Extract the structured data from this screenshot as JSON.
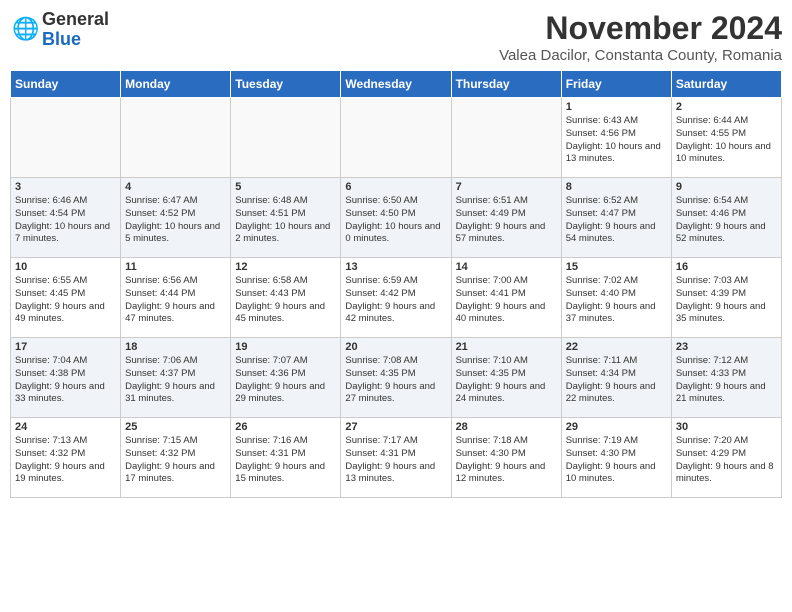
{
  "logo": {
    "general": "General",
    "blue": "Blue"
  },
  "title": "November 2024",
  "subtitle": "Valea Dacilor, Constanta County, Romania",
  "days_of_week": [
    "Sunday",
    "Monday",
    "Tuesday",
    "Wednesday",
    "Thursday",
    "Friday",
    "Saturday"
  ],
  "weeks": [
    [
      {
        "day": "",
        "info": ""
      },
      {
        "day": "",
        "info": ""
      },
      {
        "day": "",
        "info": ""
      },
      {
        "day": "",
        "info": ""
      },
      {
        "day": "",
        "info": ""
      },
      {
        "day": "1",
        "info": "Sunrise: 6:43 AM\nSunset: 4:56 PM\nDaylight: 10 hours and 13 minutes."
      },
      {
        "day": "2",
        "info": "Sunrise: 6:44 AM\nSunset: 4:55 PM\nDaylight: 10 hours and 10 minutes."
      }
    ],
    [
      {
        "day": "3",
        "info": "Sunrise: 6:46 AM\nSunset: 4:54 PM\nDaylight: 10 hours and 7 minutes."
      },
      {
        "day": "4",
        "info": "Sunrise: 6:47 AM\nSunset: 4:52 PM\nDaylight: 10 hours and 5 minutes."
      },
      {
        "day": "5",
        "info": "Sunrise: 6:48 AM\nSunset: 4:51 PM\nDaylight: 10 hours and 2 minutes."
      },
      {
        "day": "6",
        "info": "Sunrise: 6:50 AM\nSunset: 4:50 PM\nDaylight: 10 hours and 0 minutes."
      },
      {
        "day": "7",
        "info": "Sunrise: 6:51 AM\nSunset: 4:49 PM\nDaylight: 9 hours and 57 minutes."
      },
      {
        "day": "8",
        "info": "Sunrise: 6:52 AM\nSunset: 4:47 PM\nDaylight: 9 hours and 54 minutes."
      },
      {
        "day": "9",
        "info": "Sunrise: 6:54 AM\nSunset: 4:46 PM\nDaylight: 9 hours and 52 minutes."
      }
    ],
    [
      {
        "day": "10",
        "info": "Sunrise: 6:55 AM\nSunset: 4:45 PM\nDaylight: 9 hours and 49 minutes."
      },
      {
        "day": "11",
        "info": "Sunrise: 6:56 AM\nSunset: 4:44 PM\nDaylight: 9 hours and 47 minutes."
      },
      {
        "day": "12",
        "info": "Sunrise: 6:58 AM\nSunset: 4:43 PM\nDaylight: 9 hours and 45 minutes."
      },
      {
        "day": "13",
        "info": "Sunrise: 6:59 AM\nSunset: 4:42 PM\nDaylight: 9 hours and 42 minutes."
      },
      {
        "day": "14",
        "info": "Sunrise: 7:00 AM\nSunset: 4:41 PM\nDaylight: 9 hours and 40 minutes."
      },
      {
        "day": "15",
        "info": "Sunrise: 7:02 AM\nSunset: 4:40 PM\nDaylight: 9 hours and 37 minutes."
      },
      {
        "day": "16",
        "info": "Sunrise: 7:03 AM\nSunset: 4:39 PM\nDaylight: 9 hours and 35 minutes."
      }
    ],
    [
      {
        "day": "17",
        "info": "Sunrise: 7:04 AM\nSunset: 4:38 PM\nDaylight: 9 hours and 33 minutes."
      },
      {
        "day": "18",
        "info": "Sunrise: 7:06 AM\nSunset: 4:37 PM\nDaylight: 9 hours and 31 minutes."
      },
      {
        "day": "19",
        "info": "Sunrise: 7:07 AM\nSunset: 4:36 PM\nDaylight: 9 hours and 29 minutes."
      },
      {
        "day": "20",
        "info": "Sunrise: 7:08 AM\nSunset: 4:35 PM\nDaylight: 9 hours and 27 minutes."
      },
      {
        "day": "21",
        "info": "Sunrise: 7:10 AM\nSunset: 4:35 PM\nDaylight: 9 hours and 24 minutes."
      },
      {
        "day": "22",
        "info": "Sunrise: 7:11 AM\nSunset: 4:34 PM\nDaylight: 9 hours and 22 minutes."
      },
      {
        "day": "23",
        "info": "Sunrise: 7:12 AM\nSunset: 4:33 PM\nDaylight: 9 hours and 21 minutes."
      }
    ],
    [
      {
        "day": "24",
        "info": "Sunrise: 7:13 AM\nSunset: 4:32 PM\nDaylight: 9 hours and 19 minutes."
      },
      {
        "day": "25",
        "info": "Sunrise: 7:15 AM\nSunset: 4:32 PM\nDaylight: 9 hours and 17 minutes."
      },
      {
        "day": "26",
        "info": "Sunrise: 7:16 AM\nSunset: 4:31 PM\nDaylight: 9 hours and 15 minutes."
      },
      {
        "day": "27",
        "info": "Sunrise: 7:17 AM\nSunset: 4:31 PM\nDaylight: 9 hours and 13 minutes."
      },
      {
        "day": "28",
        "info": "Sunrise: 7:18 AM\nSunset: 4:30 PM\nDaylight: 9 hours and 12 minutes."
      },
      {
        "day": "29",
        "info": "Sunrise: 7:19 AM\nSunset: 4:30 PM\nDaylight: 9 hours and 10 minutes."
      },
      {
        "day": "30",
        "info": "Sunrise: 7:20 AM\nSunset: 4:29 PM\nDaylight: 9 hours and 8 minutes."
      }
    ]
  ]
}
